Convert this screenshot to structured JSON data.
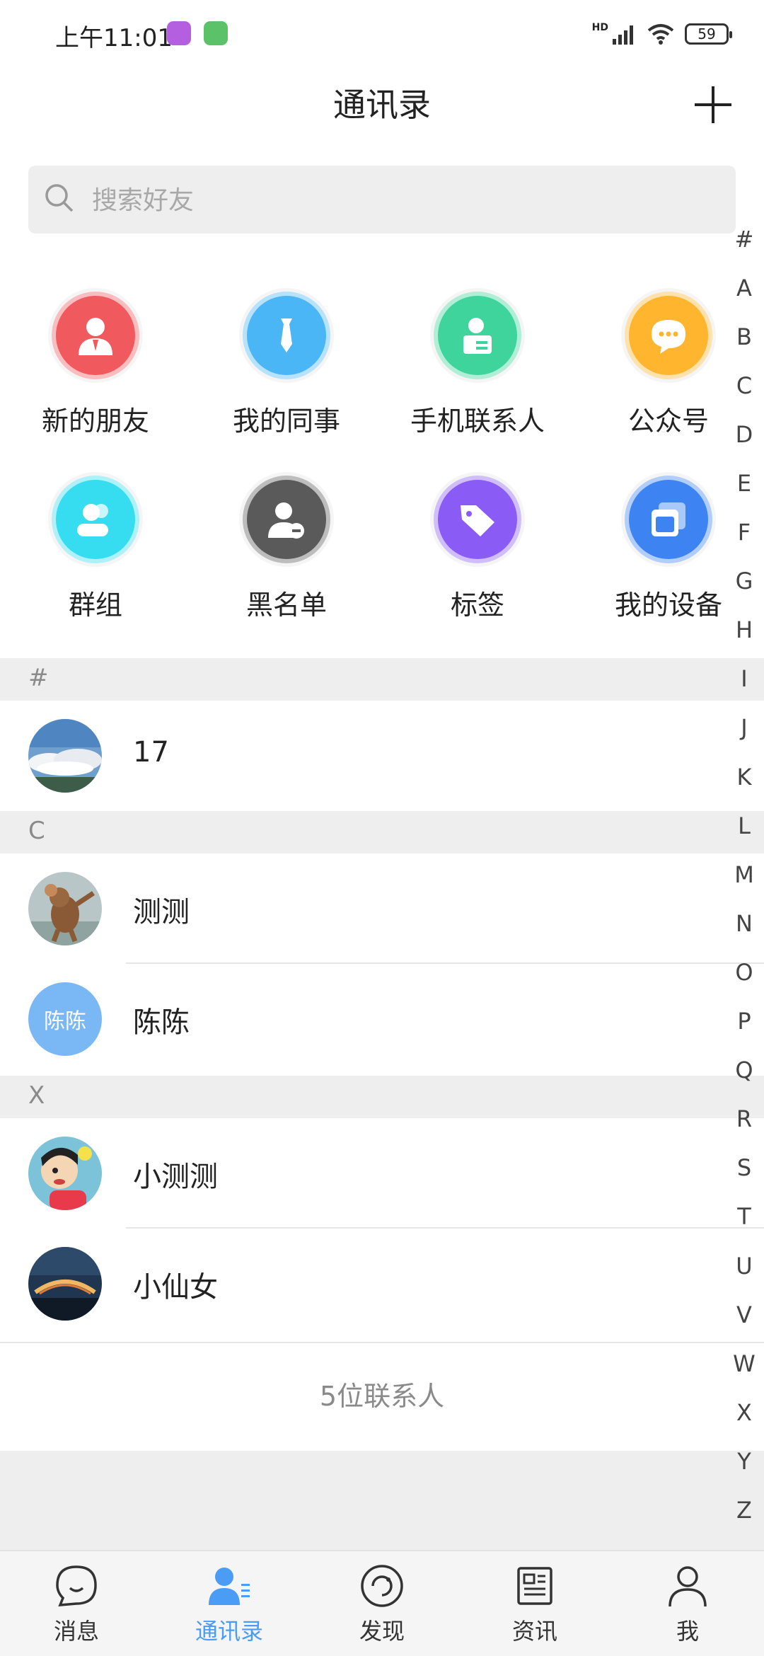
{
  "status_bar": {
    "time": "上午11:01",
    "battery": "59",
    "hd_label": "HD"
  },
  "header": {
    "title": "通讯录"
  },
  "search": {
    "placeholder": "搜索好友"
  },
  "features": [
    {
      "label": "新的朋友",
      "icon": "new-friend-icon",
      "color": "#f05a5f"
    },
    {
      "label": "我的同事",
      "icon": "colleague-icon",
      "color": "#4bb6f5"
    },
    {
      "label": "手机联系人",
      "icon": "phone-contacts-icon",
      "color": "#3ed49c"
    },
    {
      "label": "公众号",
      "icon": "official-account-icon",
      "color": "#ffb52e"
    },
    {
      "label": "群组",
      "icon": "group-icon",
      "color": "#36dcef"
    },
    {
      "label": "黑名单",
      "icon": "blacklist-icon",
      "color": "#5a5a5a"
    },
    {
      "label": "标签",
      "icon": "tag-icon",
      "color": "#8a5cf5"
    },
    {
      "label": "我的设备",
      "icon": "device-icon",
      "color": "#3d84f2"
    }
  ],
  "sections": [
    {
      "letter": "#",
      "contacts": [
        {
          "name": "17",
          "avatar": "sky-photo"
        }
      ]
    },
    {
      "letter": "C",
      "contacts": [
        {
          "name": "测测",
          "avatar": "cartoon-mouse"
        },
        {
          "name": "陈陈",
          "avatar_text": "陈陈",
          "avatar_color": "#7ab8f5"
        }
      ]
    },
    {
      "letter": "X",
      "contacts": [
        {
          "name": "小测测",
          "avatar": "cartoon-boy"
        },
        {
          "name": "小仙女",
          "avatar": "night-sky"
        }
      ]
    }
  ],
  "contact_count": "5位联系人",
  "index_letters": [
    "#",
    "A",
    "B",
    "C",
    "D",
    "E",
    "F",
    "G",
    "H",
    "I",
    "J",
    "K",
    "L",
    "M",
    "N",
    "O",
    "P",
    "Q",
    "R",
    "S",
    "T",
    "U",
    "V",
    "W",
    "X",
    "Y",
    "Z"
  ],
  "nav": [
    {
      "label": "消息",
      "icon": "chat-bubble-icon"
    },
    {
      "label": "通讯录",
      "icon": "contacts-icon",
      "active": true
    },
    {
      "label": "发现",
      "icon": "discover-icon"
    },
    {
      "label": "资讯",
      "icon": "news-icon"
    },
    {
      "label": "我",
      "icon": "profile-icon"
    }
  ],
  "colors": {
    "accent": "#4a9cf5",
    "section_bg": "#eeeeee"
  }
}
